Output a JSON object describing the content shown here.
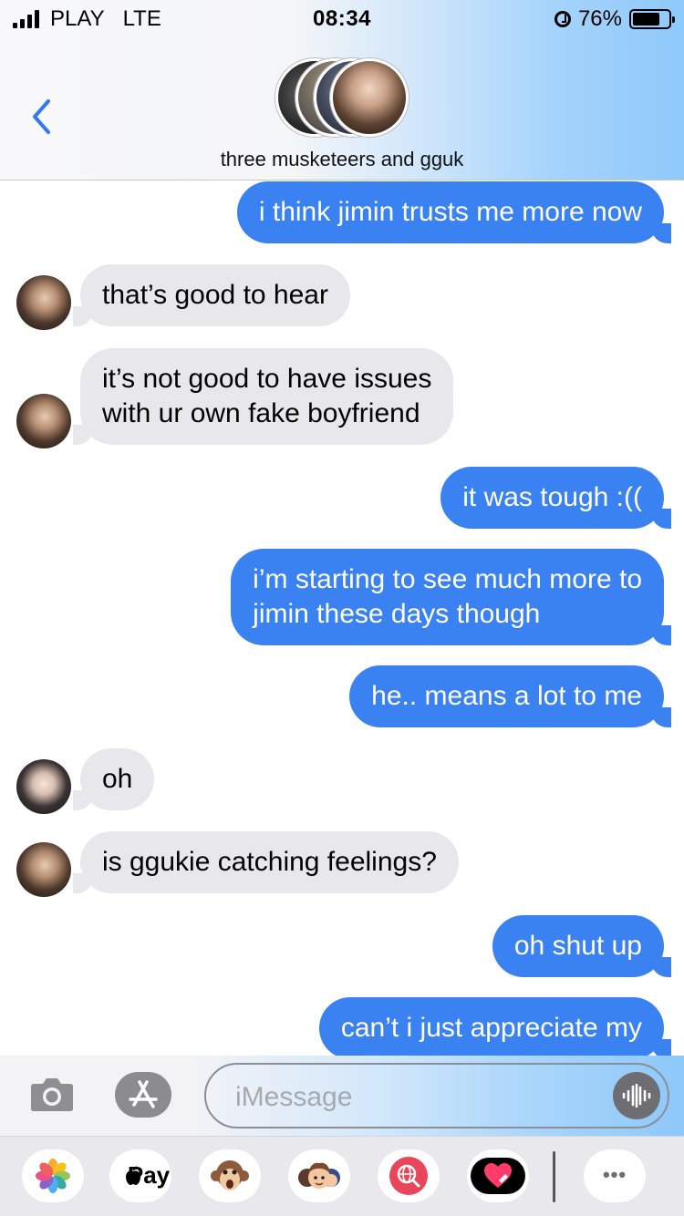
{
  "status_bar": {
    "carrier": "PLAY",
    "network": "LTE",
    "time": "08:34",
    "battery_percent": "76%",
    "battery_level": 0.76
  },
  "header": {
    "group_name": "three musketeers and gguk"
  },
  "messages": [
    {
      "dir": "out",
      "lines": [
        "i think jimin trusts me more now"
      ]
    },
    {
      "dir": "in",
      "avatar": "jk",
      "lines": [
        "that’s good to hear"
      ]
    },
    {
      "dir": "in",
      "avatar": "jk",
      "lines": [
        "it’s not good to have issues",
        "with ur own fake boyfriend"
      ]
    },
    {
      "dir": "out",
      "lines": [
        "it was tough :(("
      ]
    },
    {
      "dir": "out",
      "lines": [
        "i’m starting to see much more to",
        "jimin these days though"
      ]
    },
    {
      "dir": "out",
      "lines": [
        "he.. means a lot to me"
      ]
    },
    {
      "dir": "in",
      "avatar": "jm",
      "lines": [
        "oh"
      ]
    },
    {
      "dir": "in",
      "avatar": "jk",
      "lines": [
        "is ggukie catching feelings?"
      ]
    },
    {
      "dir": "out",
      "lines": [
        "oh shut up"
      ]
    },
    {
      "dir": "out",
      "lines": [
        "can’t i just appreciate my"
      ]
    }
  ],
  "input": {
    "placeholder": "iMessage"
  },
  "app_drawer": {
    "apple_pay_label": "Pay",
    "more_label": "•••"
  },
  "colors": {
    "outgoing_bubble": "#3a82f1",
    "incoming_bubble": "#e7e7ec",
    "ios_blue": "#3478f6"
  }
}
